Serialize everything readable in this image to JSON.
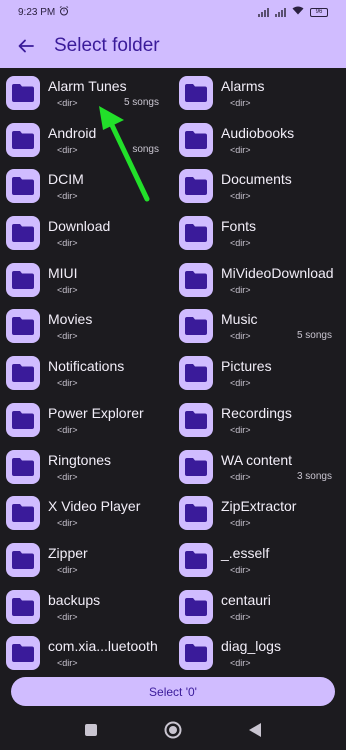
{
  "status_bar": {
    "time": "9:23 PM",
    "battery": "96"
  },
  "app_bar": {
    "title": "Select folder",
    "back_icon": "arrow-left-icon"
  },
  "folders": [
    {
      "name": "Alarm Tunes",
      "sub": "<dir>",
      "count": "5 songs"
    },
    {
      "name": "Alarms",
      "sub": "<dir>",
      "count": ""
    },
    {
      "name": "Android",
      "sub": "<dir>",
      "count": "songs"
    },
    {
      "name": "Audiobooks",
      "sub": "<dir>",
      "count": ""
    },
    {
      "name": "DCIM",
      "sub": "<dir>",
      "count": ""
    },
    {
      "name": "Documents",
      "sub": "<dir>",
      "count": ""
    },
    {
      "name": "Download",
      "sub": "<dir>",
      "count": ""
    },
    {
      "name": "Fonts",
      "sub": "<dir>",
      "count": ""
    },
    {
      "name": "MIUI",
      "sub": "<dir>",
      "count": ""
    },
    {
      "name": "MiVideoDownload",
      "sub": "<dir>",
      "count": ""
    },
    {
      "name": "Movies",
      "sub": "<dir>",
      "count": ""
    },
    {
      "name": "Music",
      "sub": "<dir>",
      "count": "5 songs"
    },
    {
      "name": "Notifications",
      "sub": "<dir>",
      "count": ""
    },
    {
      "name": "Pictures",
      "sub": "<dir>",
      "count": ""
    },
    {
      "name": "Power Explorer",
      "sub": "<dir>",
      "count": ""
    },
    {
      "name": "Recordings",
      "sub": "<dir>",
      "count": ""
    },
    {
      "name": "Ringtones",
      "sub": "<dir>",
      "count": ""
    },
    {
      "name": "WA content",
      "sub": "<dir>",
      "count": "3 songs"
    },
    {
      "name": "X Video Player",
      "sub": "<dir>",
      "count": ""
    },
    {
      "name": "ZipExtractor",
      "sub": "<dir>",
      "count": ""
    },
    {
      "name": "Zipper",
      "sub": "<dir>",
      "count": ""
    },
    {
      "name": "_.esself",
      "sub": "<dir>",
      "count": ""
    },
    {
      "name": "backups",
      "sub": "<dir>",
      "count": ""
    },
    {
      "name": "centauri",
      "sub": "<dir>",
      "count": ""
    },
    {
      "name": "com.xia...luetooth",
      "sub": "<dir>",
      "count": ""
    },
    {
      "name": "diag_logs",
      "sub": "<dir>",
      "count": ""
    }
  ],
  "select_button": {
    "label": "Select '0'"
  },
  "colors": {
    "accent": "#d0bcff",
    "folder_icon": "#3a1b9a",
    "background": "#1c1b1f",
    "annotation_arrow": "#22e02a"
  }
}
